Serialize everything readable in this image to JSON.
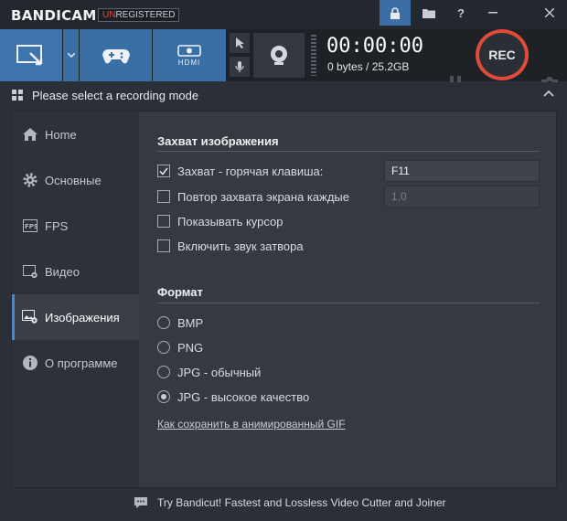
{
  "app": {
    "logo": "BANDICAM",
    "badge_un": "UN",
    "badge_rest": "REGISTERED"
  },
  "toolbar": {
    "hdmi_label": "HDMI",
    "timer": "00:00:00",
    "size": "0 bytes / 25.2GB",
    "rec_label": "REC"
  },
  "mode_bar": {
    "text": "Please select a recording mode"
  },
  "sidebar": {
    "items": [
      {
        "label": "Home",
        "icon": "home-icon"
      },
      {
        "label": "Основные",
        "icon": "gear-icon"
      },
      {
        "label": "FPS",
        "icon": "fps-icon"
      },
      {
        "label": "Видео",
        "icon": "video-icon"
      },
      {
        "label": "Изображения",
        "icon": "image-settings-icon",
        "active": true
      },
      {
        "label": "О программе",
        "icon": "info-icon"
      }
    ]
  },
  "capture": {
    "title": "Захват изображения",
    "hotkey": {
      "label": "Захват - горячая клавиша:",
      "checked": true,
      "value": "F11"
    },
    "repeat": {
      "label": "Повтор захвата экрана каждые",
      "checked": false,
      "value": "1,0"
    },
    "cursor": {
      "label": "Показывать курсор",
      "checked": false
    },
    "shutter": {
      "label": "Включить звук затвора",
      "checked": false
    }
  },
  "format": {
    "title": "Формат",
    "options": [
      "BMP",
      "PNG",
      "JPG - обычный",
      "JPG - высокое качество"
    ],
    "selected": "JPG - высокое качество"
  },
  "gif_link": "Как сохранить в анимированный GIF",
  "footer": {
    "text": "Try Bandicut! Fastest and Lossless Video Cutter and Joiner"
  },
  "colors": {
    "accent_blue": "#3a6fa6",
    "rec_red": "#e04a3a",
    "active_indicator": "#3b8de0"
  }
}
